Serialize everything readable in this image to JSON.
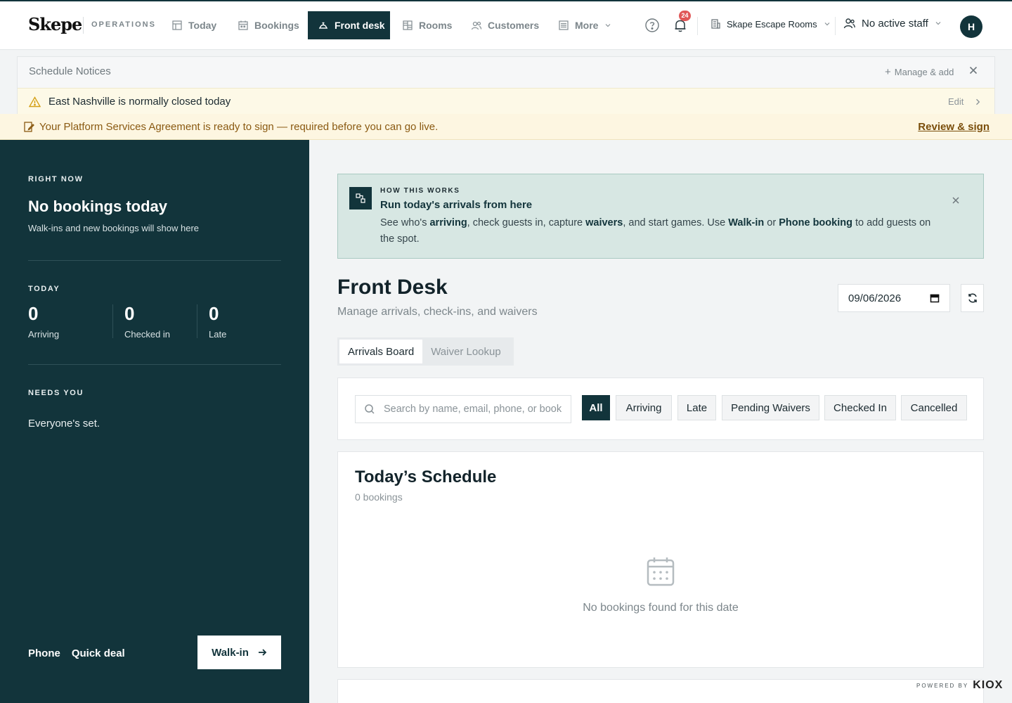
{
  "nav": {
    "logo": "Skepe",
    "section": "OPERATIONS",
    "items": [
      {
        "label": "Today",
        "icon": "calendar-grid-icon"
      },
      {
        "label": "Bookings",
        "icon": "calendar-icon"
      },
      {
        "label": "Front desk",
        "icon": "bell-desk-icon",
        "active": true
      },
      {
        "label": "Rooms",
        "icon": "rooms-grid-icon"
      },
      {
        "label": "Customers",
        "icon": "users-icon"
      },
      {
        "label": "More",
        "icon": "menu-list-icon"
      }
    ],
    "notification_count": "24",
    "venue": "Skape Escape Rooms",
    "staff": "No active staff",
    "avatar_initial": "H"
  },
  "notices": {
    "title": "Schedule Notices",
    "manage_label": "Manage & add",
    "items": [
      {
        "text": "East Nashville is normally closed today",
        "action": "Edit"
      }
    ]
  },
  "agreement": {
    "text": "Your Platform Services Agreement is ready to sign — required before you can go live.",
    "link": "Review & sign"
  },
  "sidebar": {
    "right_now_label": "RIGHT NOW",
    "headline": "No bookings today",
    "subtext": "Walk-ins and new bookings will show here",
    "today_label": "TODAY",
    "stats": [
      {
        "value": "0",
        "label": "Arriving"
      },
      {
        "value": "0",
        "label": "Checked in"
      },
      {
        "value": "0",
        "label": "Late"
      }
    ],
    "needs_label": "NEEDS YOU",
    "needs_text": "Everyone's set.",
    "phone_label": "Phone",
    "quick_deal_label": "Quick deal",
    "walkin_label": "Walk-in"
  },
  "how_it_works": {
    "eyebrow": "HOW THIS WORKS",
    "title": "Run today's arrivals from here",
    "text_parts": [
      "See who's ",
      "arriving",
      ", check guests in, capture ",
      "waivers",
      ", and start games. Use ",
      "Walk-in",
      " or ",
      "Phone booking",
      " to add guests on the spot."
    ]
  },
  "main": {
    "title": "Front Desk",
    "subtitle": "Manage arrivals, check-ins, and waivers",
    "date": "09/06/2026",
    "tabs": [
      "Arrivals Board",
      "Waiver Lookup"
    ],
    "search_placeholder": "Search by name, email, phone, or booking",
    "filters": [
      "All",
      "Arriving",
      "Late",
      "Pending Waivers",
      "Checked In",
      "Cancelled"
    ],
    "schedule_title": "Today’s Schedule",
    "schedule_count": "0 bookings",
    "empty_text": "No bookings found for this date"
  },
  "footer": {
    "powered_by": "POWERED BY",
    "brand": "KIOX"
  },
  "colors": {
    "primary": "#12343b",
    "notice_bg": "#fdf9e7",
    "agreement_text": "#8a5a12",
    "info_bg": "#d7e7e3",
    "badge": "#e05757"
  }
}
